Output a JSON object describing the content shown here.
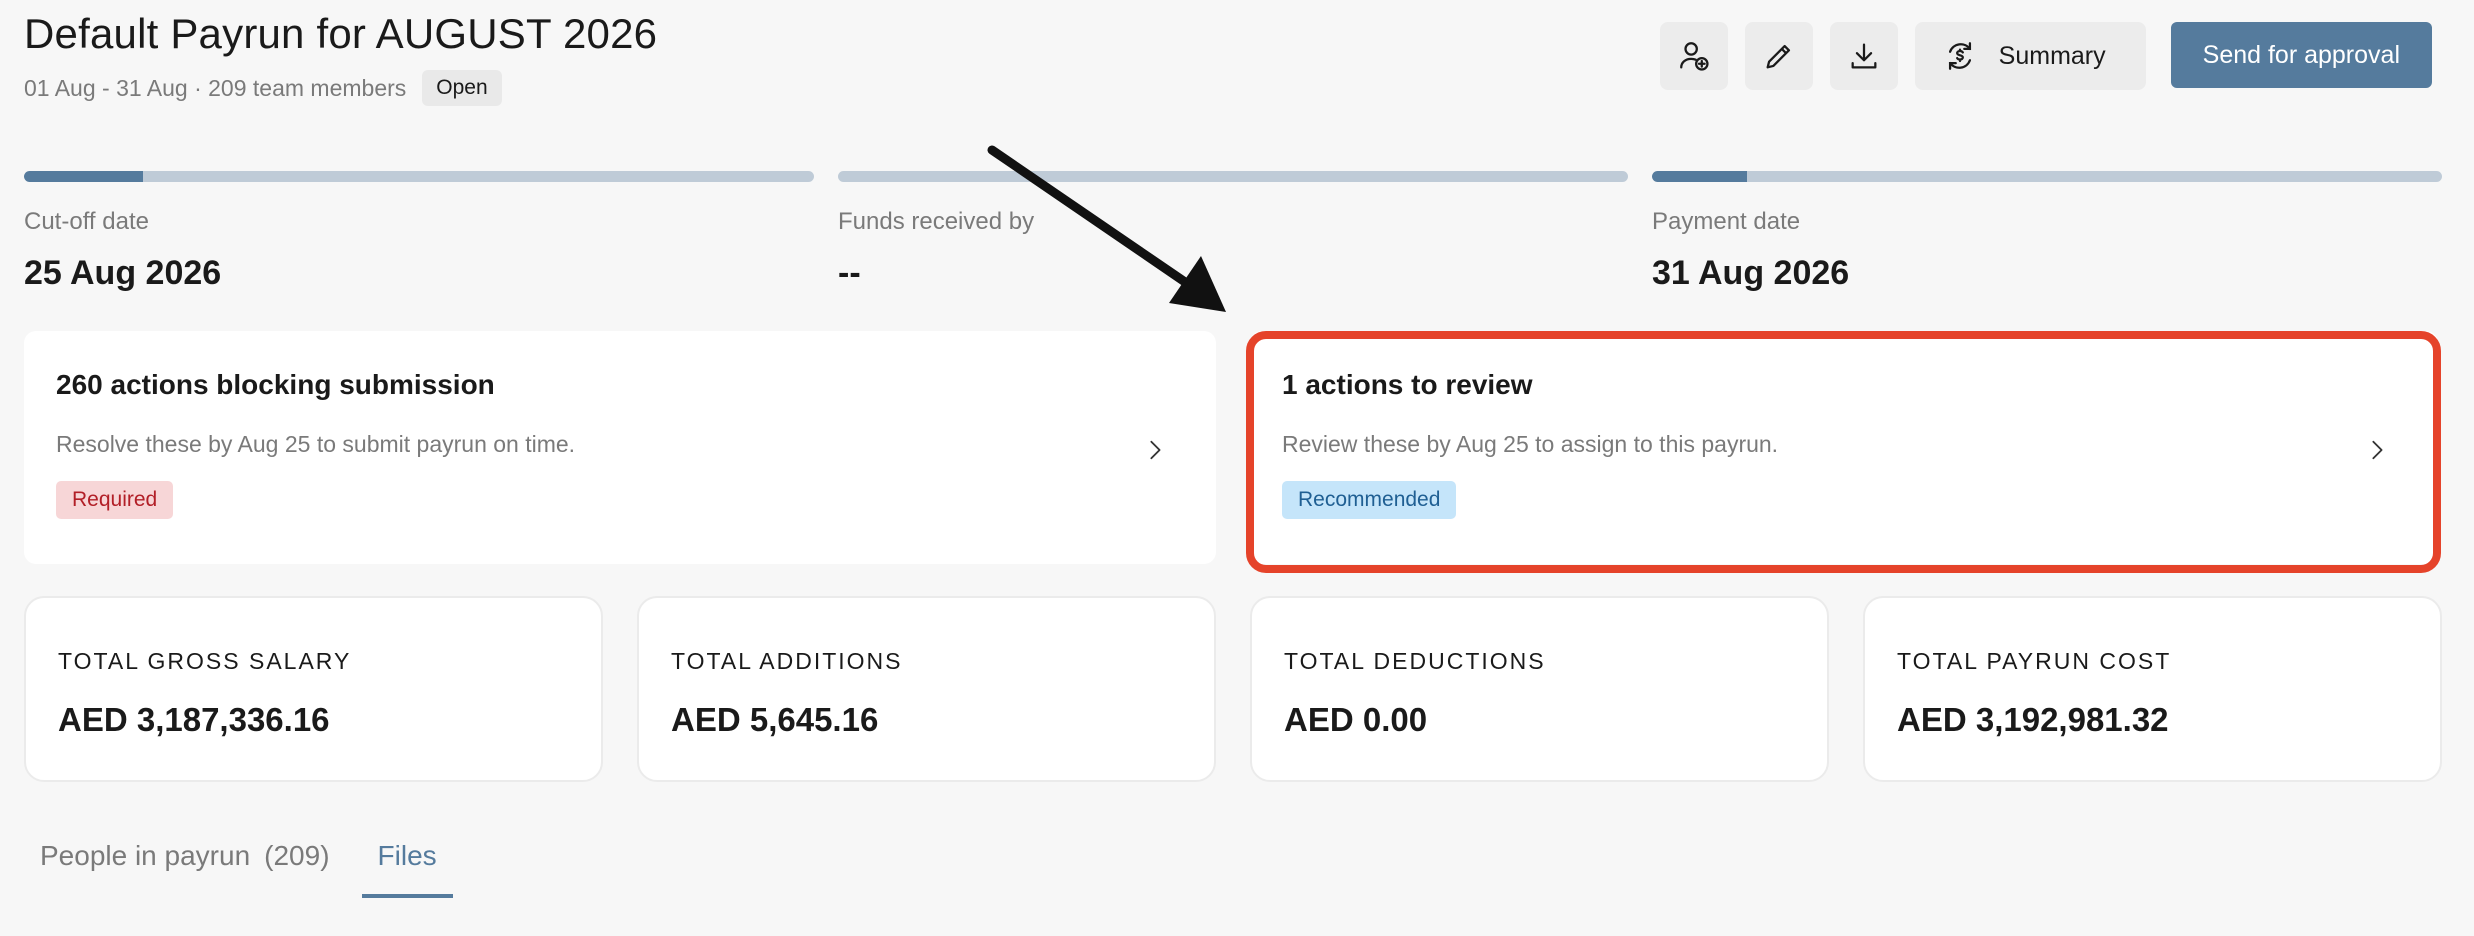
{
  "header": {
    "title": "Default Payrun for AUGUST 2026",
    "subtitle": "01 Aug - 31 Aug · 209 team members",
    "status_badge": "Open"
  },
  "toolbar": {
    "add_member_icon": "user-add-icon",
    "edit_icon": "pencil-icon",
    "download_icon": "download-icon",
    "summary_icon": "sync-dollar-icon",
    "summary_label": "Summary",
    "send_label": "Send for approval"
  },
  "milestones": [
    {
      "label": "Cut-off date",
      "value": "25 Aug 2026",
      "progress": 0.15
    },
    {
      "label": "Funds received by",
      "value": "--",
      "progress": 0.0
    },
    {
      "label": "Payment date",
      "value": "31 Aug 2026",
      "progress": 0.12
    }
  ],
  "action_cards": {
    "blocking": {
      "title": "260 actions blocking submission",
      "description": "Resolve these by Aug 25 to submit payrun on time.",
      "tag": "Required"
    },
    "review": {
      "title": "1 actions to review",
      "description": "Review these by Aug 25 to assign to this payrun.",
      "tag": "Recommended"
    }
  },
  "totals": [
    {
      "label": "TOTAL GROSS SALARY",
      "value": "AED 3,187,336.16"
    },
    {
      "label": "TOTAL ADDITIONS",
      "value": "AED 5,645.16"
    },
    {
      "label": "TOTAL DEDUCTIONS",
      "value": "AED 0.00"
    },
    {
      "label": "TOTAL PAYRUN COST",
      "value": "AED 3,192,981.32"
    }
  ],
  "tabs": {
    "people_label": "People in payrun",
    "people_count": "(209)",
    "files_label": "Files",
    "active": "Files"
  },
  "colors": {
    "primary": "#557b9d",
    "highlight": "#e5432a",
    "required_bg": "#f7d6d7",
    "recommended_bg": "#c5e5fa"
  }
}
